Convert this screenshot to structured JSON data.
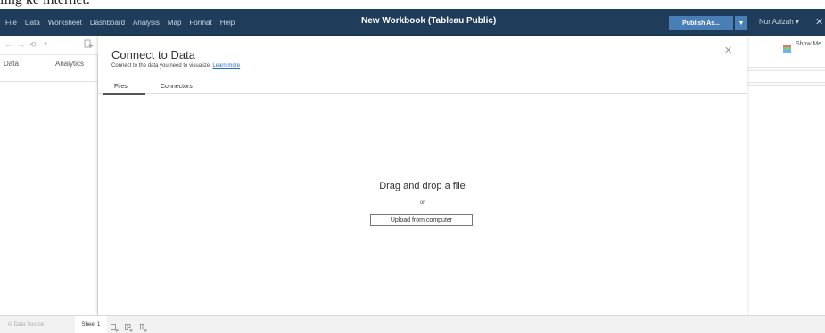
{
  "top_strip": {
    "text": "ling ke internet."
  },
  "menubar": {
    "items": [
      "File",
      "Data",
      "Worksheet",
      "Dashboard",
      "Analysis",
      "Map",
      "Format",
      "Help"
    ],
    "title": "New Workbook (Tableau Public)",
    "publish_label": "Publish As...",
    "publish_caret": "▼",
    "user_label": "Nur Azizah ▾",
    "close_glyph": "✕"
  },
  "toolbar": {
    "icons": [
      "arrow-left-icon",
      "arrow-right-icon",
      "redo-icon",
      "chevron-down-icon",
      "new-datasource-icon"
    ]
  },
  "left_panel": {
    "tabs": [
      "Data",
      "Analytics"
    ]
  },
  "right_toolbar": {
    "showme_label": "Show Me"
  },
  "dialog": {
    "title": "Connect to Data",
    "subtitle": "Connect to the data you need to visualize.",
    "learn_more": "Learn more",
    "close_glyph": "✕",
    "tabs": [
      "Files",
      "Connectors"
    ],
    "drop_title": "Drag and drop a file",
    "drop_or": "or",
    "upload_label": "Upload from computer"
  },
  "statusbar": {
    "data_source_label": "Data Source",
    "sheet_label": "Sheet 1"
  },
  "colors": {
    "menubar": "#1f3d5a",
    "publish": "#4a7fb5",
    "link": "#1f6fc5"
  }
}
